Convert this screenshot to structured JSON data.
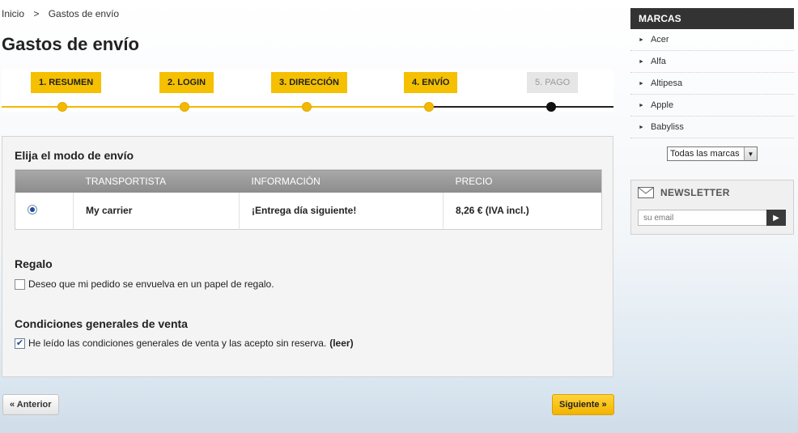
{
  "breadcrumb": {
    "home": "Inicio",
    "separator": ">",
    "current": "Gastos de envío"
  },
  "page_title": "Gastos de envío",
  "steps": [
    {
      "label": "1. RESUMEN",
      "state": "done"
    },
    {
      "label": "2. LOGIN",
      "state": "done"
    },
    {
      "label": "3. DIRECCIÓN",
      "state": "done"
    },
    {
      "label": "4. ENVÍO",
      "state": "current"
    },
    {
      "label": "5. PAGO",
      "state": "todo"
    }
  ],
  "shipping": {
    "title": "Elija el modo de envío",
    "columns": [
      "",
      "TRANSPORTISTA",
      "INFORMACIÓN",
      "PRECIO"
    ],
    "rows": [
      {
        "selected": true,
        "carrier": "My carrier",
        "info": "¡Entrega día siguiente!",
        "price": "8,26 € (IVA incl.)"
      }
    ]
  },
  "gift": {
    "title": "Regalo",
    "checkbox_label": "Deseo que mi pedido se envuelva en un papel de regalo.",
    "checked": false
  },
  "terms": {
    "title": "Condiciones generales de venta",
    "checkbox_label": "He leído las condiciones generales de venta y las acepto sin reserva.",
    "read_link": "(leer)",
    "checked": true
  },
  "buttons": {
    "previous": "« Anterior",
    "next": "Siguiente »"
  },
  "sidebar": {
    "brands_title": "MARCAS",
    "brands": [
      "Acer",
      "Alfa",
      "Altipesa",
      "Apple",
      "Babyliss"
    ],
    "brands_select": "Todas las marcas",
    "newsletter_title": "NEWSLETTER",
    "newsletter_placeholder": "su email"
  },
  "colors": {
    "accent": "#f5c000",
    "sidebar_header": "#333333",
    "table_header": "#999999"
  }
}
